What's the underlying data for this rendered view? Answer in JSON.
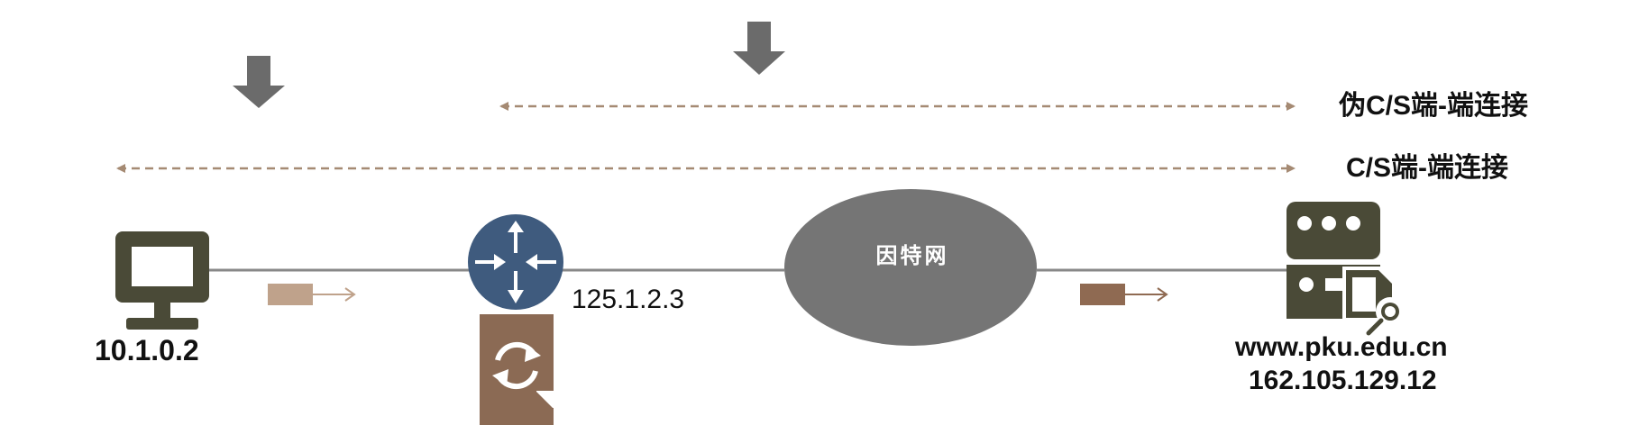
{
  "connections": {
    "pseudo_label": "伪C/S端-端连接",
    "cs_label": "C/S端-端连接"
  },
  "nodes": {
    "client_ip": "10.1.0.2",
    "router_ip": "125.1.2.3",
    "internet_label": "因特网",
    "server_domain": "www.pku.edu.cn",
    "server_ip": "162.105.129.12"
  },
  "colors": {
    "arrow_gray": "#6b6b6b",
    "dashed_brown": "#a58a73",
    "monitor": "#4a4a37",
    "router": "#3f5b7e",
    "nat_doc": "#8b6a54",
    "cloud": "#757575",
    "line": "#888888",
    "packet_left": "#bfa28b",
    "packet_right": "#8f6a52"
  },
  "icons": [
    "down-arrow-icon",
    "monitor-icon",
    "router-icon",
    "nat-refresh-doc-icon",
    "internet-cloud",
    "server-search-icon"
  ]
}
